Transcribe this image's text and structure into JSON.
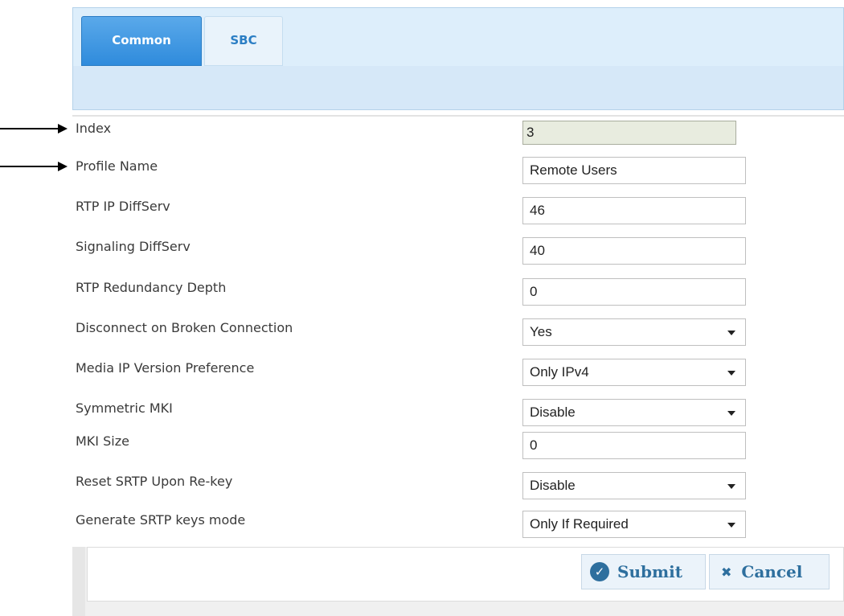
{
  "tabs": [
    {
      "label": "Common",
      "active": true
    },
    {
      "label": "SBC",
      "active": false
    }
  ],
  "fields": {
    "index": {
      "label": "Index",
      "value": "3"
    },
    "profile_name": {
      "label": "Profile Name",
      "value": "Remote Users"
    },
    "rtp_ip_diffserv": {
      "label": "RTP IP DiffServ",
      "value": "46"
    },
    "signaling_diffserv": {
      "label": "Signaling DiffServ",
      "value": "40"
    },
    "rtp_redundancy_depth": {
      "label": "RTP Redundancy Depth",
      "value": "0"
    },
    "disconnect_on_broken_connection": {
      "label": "Disconnect on Broken Connection",
      "value": "Yes"
    },
    "media_ip_version_preference": {
      "label": "Media IP Version Preference",
      "value": "Only IPv4"
    },
    "symmetric_mki": {
      "label": "Symmetric MKI",
      "value": "Disable"
    },
    "mki_size": {
      "label": "MKI Size",
      "value": "0"
    },
    "reset_srtp_upon_rekey": {
      "label": "Reset SRTP Upon Re-key",
      "value": "Disable"
    },
    "generate_srtp_keys_mode": {
      "label": "Generate SRTP keys mode",
      "value": "Only If Required"
    }
  },
  "buttons": {
    "submit": "Submit",
    "cancel": "Cancel"
  },
  "colors": {
    "active_tab": "#2f8bdc",
    "tab_bar": "#ddeefb",
    "button_text": "#2e6f9e"
  }
}
